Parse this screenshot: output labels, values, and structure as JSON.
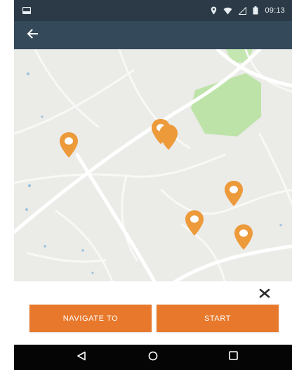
{
  "status_bar": {
    "time": "09:13",
    "icons": [
      "notification-icon",
      "location-icon",
      "wifi-icon",
      "signal-icon",
      "battery-icon"
    ]
  },
  "app_bar": {
    "back_icon": "arrow-back-icon"
  },
  "map": {
    "pin_color": "#ec9a3a",
    "park_color": "#bde3a8",
    "pin_count": 6
  },
  "panel": {
    "close_icon": "close-icon",
    "navigate_label": "NAVIGATE TO",
    "start_label": "START",
    "accent": "#e8792c"
  },
  "nav_bar": {
    "items": [
      "back-icon",
      "home-icon",
      "recents-icon"
    ]
  }
}
